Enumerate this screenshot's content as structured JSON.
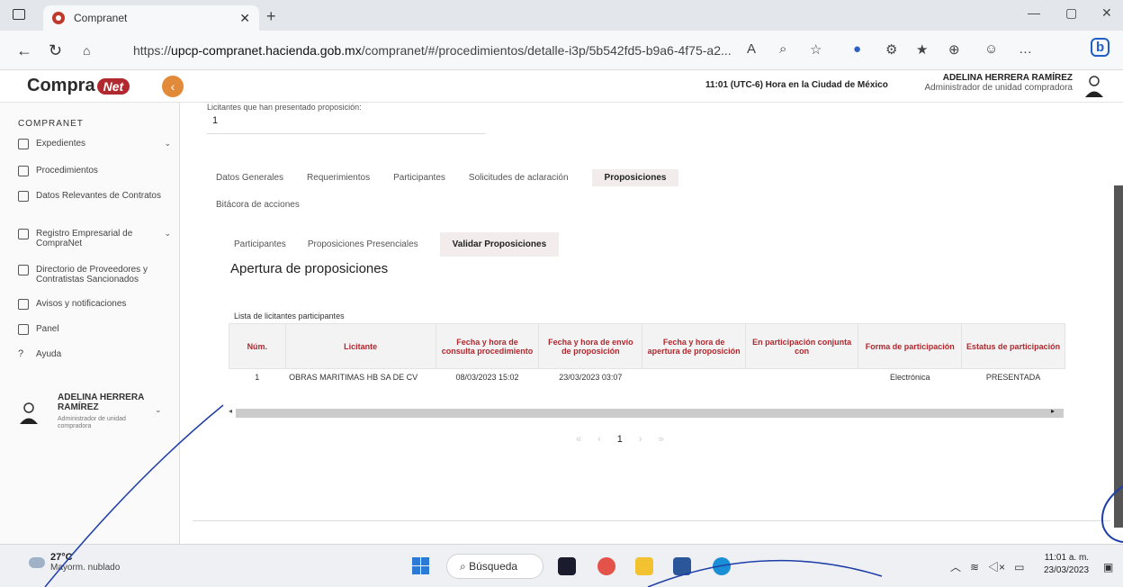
{
  "browser": {
    "tab_title": "Compranet",
    "url_prefix": "https://",
    "url_host": "upcp-compranet.hacienda.gob.mx",
    "url_path": "/compranet/#/procedimientos/detalle-i3p/5b542fd5-b9a6-4f75-a2..."
  },
  "header": {
    "logo_text": "Compra",
    "logo_badge": "Net",
    "time_text": "11:01 (UTC-6) Hora en la Ciudad de México",
    "user_name": "ADELINA HERRERA RAMÍREZ",
    "user_role": "Administrador de unidad compradora"
  },
  "sidebar": {
    "title": "COMPRANET",
    "items": [
      {
        "label": "Expedientes"
      },
      {
        "label": "Procedimientos"
      },
      {
        "label": "Datos Relevantes de Contratos"
      },
      {
        "label": "Registro Empresarial de CompraNet"
      },
      {
        "label": "Directorio de Proveedores y Contratistas Sancionados"
      },
      {
        "label": "Avisos y notificaciones"
      },
      {
        "label": "Panel"
      },
      {
        "label": "Ayuda"
      }
    ],
    "user_name": "ADELINA HERRERA RAMÍREZ",
    "user_role": "Administrador de unidad compradora"
  },
  "main": {
    "crumb_label": "Licitantes que han presentado proposición:",
    "crumb_value": "1",
    "tabs": [
      "Datos Generales",
      "Requerimientos",
      "Participantes",
      "Solicitudes de aclaración",
      "Proposiciones"
    ],
    "tab_extra": "Bitácora de acciones",
    "subtabs": [
      "Participantes",
      "Proposiciones Presenciales",
      "Validar Proposiciones"
    ],
    "section_title": "Apertura de proposiciones",
    "list_title": "Lista de licitantes participantes",
    "table": {
      "headers": [
        "Núm.",
        "Licitante",
        "Fecha y hora de consulta procedimiento",
        "Fecha y hora de envío de proposición",
        "Fecha y hora de apertura de proposición",
        "En participación conjunta con",
        "Forma de participación",
        "Estatus de participación"
      ],
      "rows": [
        [
          "1",
          "OBRAS MARITIMAS HB SA DE CV",
          "08/03/2023 15:02",
          "23/03/2023 03:07",
          "",
          "",
          "Electrónica",
          "PRESENTADA"
        ]
      ]
    },
    "pager": {
      "current": "1"
    }
  },
  "taskbar": {
    "temp": "27°C",
    "weather": "Mayorm. nublado",
    "search": "Búsqueda",
    "time": "11:01 a. m.",
    "date": "23/03/2023"
  }
}
